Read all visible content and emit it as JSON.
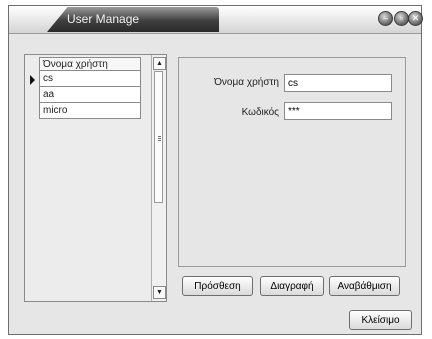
{
  "window": {
    "title": "User Manage"
  },
  "user_list": {
    "column_header": "Όνομα χρήστη",
    "rows": [
      "cs",
      "aa",
      "micro"
    ],
    "selected_index": 0
  },
  "form": {
    "username_label": "Όνομα χρήστη",
    "username_value": "cs",
    "password_label": "Κωδικός",
    "password_value": "***"
  },
  "actions": {
    "add_label": "Πρόσθεση",
    "delete_label": "Διαγραφή",
    "update_label": "Αναβάθμιση",
    "close_label": "Κλείσιμο"
  },
  "colors": {
    "title_tab": "#2a2a2a",
    "window_bg": "#e6e6e6"
  }
}
